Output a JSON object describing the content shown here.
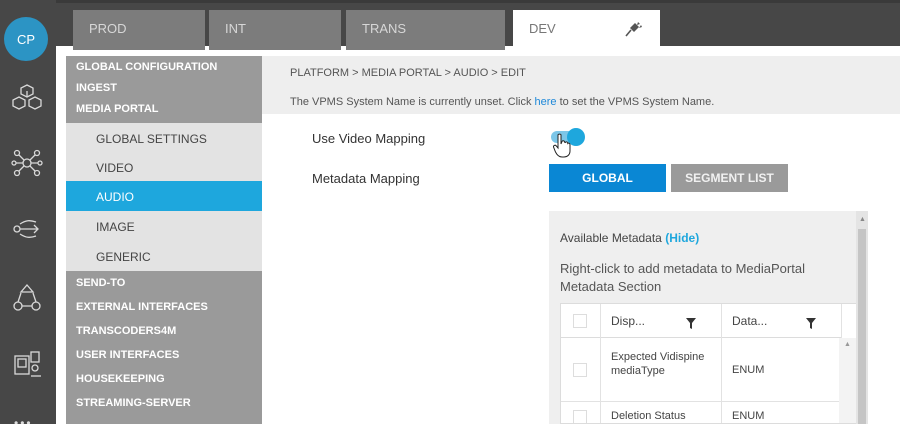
{
  "rail": {
    "logo": "CP",
    "icons": [
      "cubes-icon",
      "network-icon",
      "flow-arrows-icon",
      "workflow-icon",
      "devices-icon"
    ]
  },
  "env_tabs": [
    {
      "label": "PROD",
      "active": false
    },
    {
      "label": "INT",
      "active": false
    },
    {
      "label": "TRANS",
      "active": false
    },
    {
      "label": "DEV",
      "active": true
    }
  ],
  "nav": {
    "top_heads": [
      "GLOBAL CONFIGURATION",
      "INGEST",
      "MEDIA PORTAL"
    ],
    "sub_items": [
      {
        "label": "GLOBAL SETTINGS",
        "active": false
      },
      {
        "label": "VIDEO",
        "active": false
      },
      {
        "label": "AUDIO",
        "active": true
      },
      {
        "label": "IMAGE",
        "active": false
      },
      {
        "label": "GENERIC",
        "active": false
      }
    ],
    "bottom_heads": [
      "SEND-TO",
      "EXTERNAL INTERFACES",
      "TRANSCODERS4M",
      "USER INTERFACES",
      "HOUSEKEEPING",
      "STREAMING-SERVER"
    ]
  },
  "breadcrumb": "PLATFORM > MEDIA PORTAL > AUDIO > EDIT",
  "notice": {
    "before": "The VPMS System Name is currently unset. Click ",
    "link": "here",
    "after": " to set the VPMS System Name."
  },
  "form": {
    "video_mapping_label": "Use Video Mapping",
    "video_mapping_on": true,
    "metadata_mapping_label": "Metadata Mapping",
    "global_button": "GLOBAL",
    "segment_list_button": "SEGMENT LIST"
  },
  "metadata": {
    "title": "Available Metadata",
    "hide_link": "(Hide)",
    "hint": "Right-click to add metadata to MediaPortal Metadata Section",
    "columns": [
      "Disp...",
      "Data..."
    ],
    "rows": [
      {
        "display": "Expected Vidispine mediaType",
        "datatype": "ENUM"
      },
      {
        "display": "Deletion Status",
        "datatype": "ENUM"
      }
    ]
  },
  "colors": {
    "accent": "#1ea7dd",
    "primary_button": "#0a87d4",
    "rail": "#474747",
    "nav": "#9a9a9a"
  }
}
